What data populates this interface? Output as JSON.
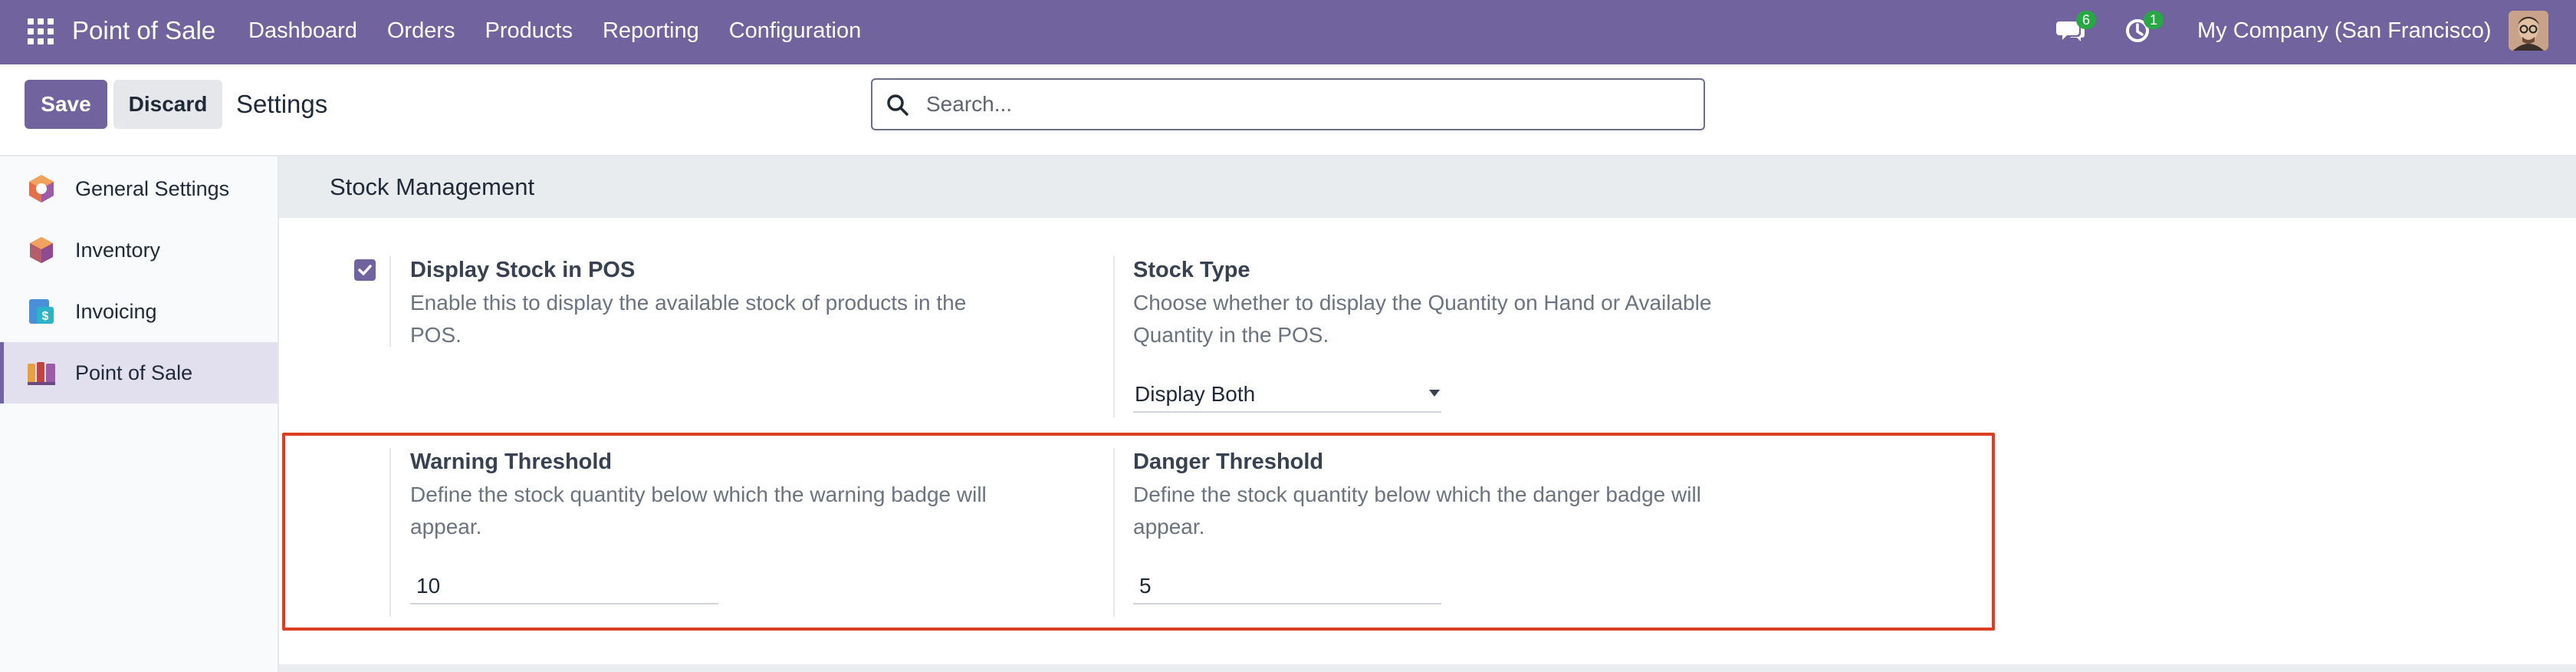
{
  "navbar": {
    "brand": "Point of Sale",
    "menu": [
      "Dashboard",
      "Orders",
      "Products",
      "Reporting",
      "Configuration"
    ],
    "messages_count": "6",
    "activities_count": "1",
    "company": "My Company (San Francisco)"
  },
  "control_panel": {
    "save_label": "Save",
    "discard_label": "Discard",
    "title": "Settings",
    "search_placeholder": "Search..."
  },
  "sidebar": {
    "items": [
      {
        "label": "General Settings",
        "icon": "odoo-settings-icon"
      },
      {
        "label": "Inventory",
        "icon": "inventory-icon"
      },
      {
        "label": "Invoicing",
        "icon": "invoicing-icon"
      },
      {
        "label": "Point of Sale",
        "icon": "point-of-sale-icon",
        "active": true
      }
    ]
  },
  "section": {
    "title": "Stock Management",
    "display_stock": {
      "title": "Display Stock in POS",
      "description": "Enable this to display the available stock of products in the POS.",
      "checked": true
    },
    "stock_type": {
      "title": "Stock Type",
      "description": "Choose whether to display the Quantity on Hand or Available Quantity in the POS.",
      "value": "Display Both"
    },
    "warning_threshold": {
      "title": "Warning Threshold",
      "description": "Define the stock quantity below which the warning badge will appear.",
      "value": "10"
    },
    "danger_threshold": {
      "title": "Danger Threshold",
      "description": "Define the stock quantity below which the danger badge will appear.",
      "value": "5"
    }
  },
  "colors": {
    "navbar": "#71639e",
    "highlight": "#dc3e24",
    "badge": "#28a745"
  }
}
